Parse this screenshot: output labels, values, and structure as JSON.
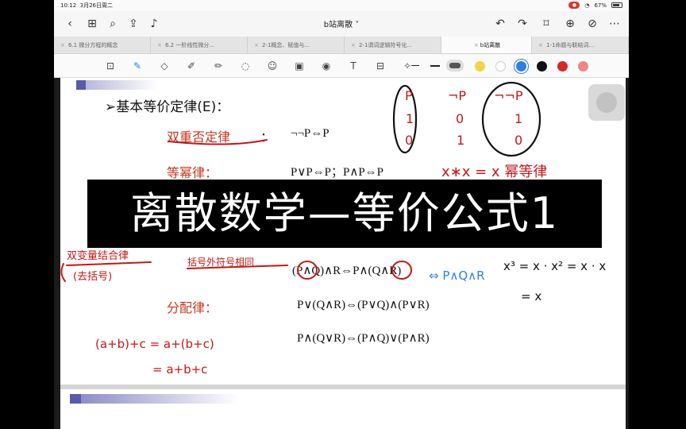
{
  "status_bar": {
    "time": "10:12",
    "date": "3月26日周二",
    "battery": "67%"
  },
  "nav": {
    "title": "b站离散 ˅"
  },
  "tabs": [
    {
      "label": "6.1 微分方程的概念"
    },
    {
      "label": "6.2 一阶线性微分..."
    },
    {
      "label": "2-1概念、赋值与..."
    },
    {
      "label": "2-1谓词逻辑符号化..."
    },
    {
      "label": "b站离散",
      "active": true
    },
    {
      "label": "1-1命题与联结词..."
    }
  ],
  "toolbar": {
    "colors": [
      "#f2d44a",
      "#ffffff",
      "#2f7fe3",
      "#111111",
      "#d22a2a",
      "#f08585"
    ],
    "active_color": "#2f7fe3"
  },
  "document": {
    "heading": "➢基本等价定律(E)：",
    "law1_name": "双重否定律",
    "law1_colon": "：",
    "law1_formula": "¬¬P⇔P",
    "law2_name": "等幂律：",
    "law2_formula": "P∨P⇔P；P∧P⇔P",
    "assoc_formula": "(P∧Q)∧R⇔P∧(Q∧R)",
    "distrib_name": "分配律：",
    "distrib_formula1": "P∨(Q∧R)⇔(P∨Q)∧(P∨R)",
    "distrib_formula2": "P∧(Q∨R)⇔(P∧Q)∨(P∧R)"
  },
  "annotations": {
    "truth_p": [
      "P",
      "1",
      "0"
    ],
    "truth_np": [
      "¬P",
      "0",
      "1"
    ],
    "truth_nnp": [
      "¬¬P",
      "1",
      "0"
    ],
    "idempotent_note": "x∗x = x 幂等律",
    "assoc_note1": "双变量结合律",
    "assoc_note2": "(去括号)",
    "assoc_note3": "括号外符号相同",
    "assoc_arrow": "⇔ P∧Q∧R",
    "power_note1": "x³ = x · x² = x · x",
    "power_note2": "= x",
    "sum_note1": "(a+b)+c = a+(b+c)",
    "sum_note2": "= a+b+c"
  },
  "banner": {
    "text": "离散数学—等价公式1"
  }
}
